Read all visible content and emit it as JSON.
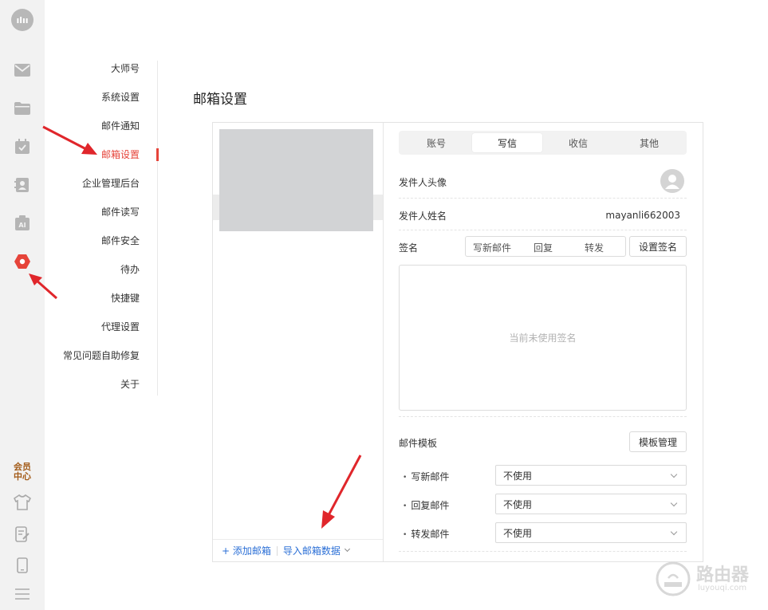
{
  "rail": {
    "logo_text": "ılıı",
    "icons": [
      "mail-icon",
      "folder-icon",
      "calendar-icon",
      "contacts-icon",
      "ai-icon",
      "settings-icon"
    ],
    "ai_text": "AI",
    "member_line1": "会员",
    "member_line2": "中心",
    "bottom_icons": [
      "shirt-icon",
      "note-edit-icon",
      "phone-icon",
      "menu-icon"
    ],
    "accent": "#e6443a"
  },
  "settings_nav": {
    "items": [
      "大师号",
      "系统设置",
      "邮件通知",
      "邮箱设置",
      "企业管理后台",
      "邮件读写",
      "邮件安全",
      "待办",
      "快捷键",
      "代理设置",
      "常见问题自助修复",
      "关于"
    ],
    "active_index": 3
  },
  "page_title": "邮箱设置",
  "accounts": {
    "add_label": "+ 添加邮箱",
    "import_label": "导入邮箱数据",
    "link_color": "#2b6fd6"
  },
  "tabs": [
    "账号",
    "写信",
    "收信",
    "其他"
  ],
  "active_tab": 1,
  "form": {
    "avatar_label": "发件人头像",
    "name_label": "发件人姓名",
    "sender_name": "mayanli662003",
    "signature_label": "签名",
    "signature_segments": [
      "写新邮件",
      "回复",
      "转发"
    ],
    "set_signature_button": "设置签名",
    "signature_empty": "当前未使用签名",
    "template_label": "邮件模板",
    "template_manage_button": "模板管理",
    "templates": [
      {
        "label": "写新邮件",
        "value": "不使用"
      },
      {
        "label": "回复邮件",
        "value": "不使用"
      },
      {
        "label": "转发邮件",
        "value": "不使用"
      }
    ]
  },
  "watermark": {
    "title": "路由器",
    "subtitle": "luyouqi.com"
  },
  "annotation_color": "#e0262b"
}
